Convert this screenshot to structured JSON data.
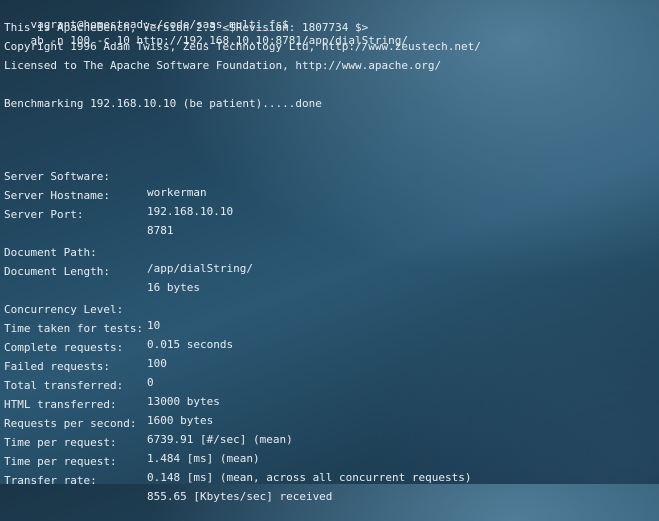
{
  "prompt": "vagrant@homestead:~/code/saas_multi_fs$",
  "command": "ab -n 100 -c 10 http://192.168.10.10:8781/app/dialString/",
  "header_lines": [
    "This is ApacheBench, Version 2.3 <$Revision: 1807734 $>",
    "Copyright 1996 Adam Twiss, Zeus Technology Ltd, http://www.zeustech.net/",
    "Licensed to The Apache Software Foundation, http://www.apache.org/"
  ],
  "benchmarking": "Benchmarking 192.168.10.10 (be patient).....done",
  "server": [
    {
      "key": "Server Software:",
      "value": "workerman"
    },
    {
      "key": "Server Hostname:",
      "value": "192.168.10.10"
    },
    {
      "key": "Server Port:",
      "value": "8781"
    }
  ],
  "document": [
    {
      "key": "Document Path:",
      "value": "/app/dialString/"
    },
    {
      "key": "Document Length:",
      "value": "16 bytes"
    }
  ],
  "results": [
    {
      "key": "Concurrency Level:",
      "value": "10"
    },
    {
      "key": "Time taken for tests:",
      "value": "0.015 seconds"
    },
    {
      "key": "Complete requests:",
      "value": "100"
    },
    {
      "key": "Failed requests:",
      "value": "0"
    },
    {
      "key": "Total transferred:",
      "value": "13000 bytes"
    },
    {
      "key": "HTML transferred:",
      "value": "1600 bytes"
    },
    {
      "key": "Requests per second:",
      "value": "6739.91 [#/sec] (mean)"
    },
    {
      "key": "Time per request:",
      "value": "1.484 [ms] (mean)"
    },
    {
      "key": "Time per request:",
      "value": "0.148 [ms] (mean, across all concurrent requests)"
    },
    {
      "key": "Transfer rate:",
      "value": "855.65 [Kbytes/sec] received"
    }
  ]
}
